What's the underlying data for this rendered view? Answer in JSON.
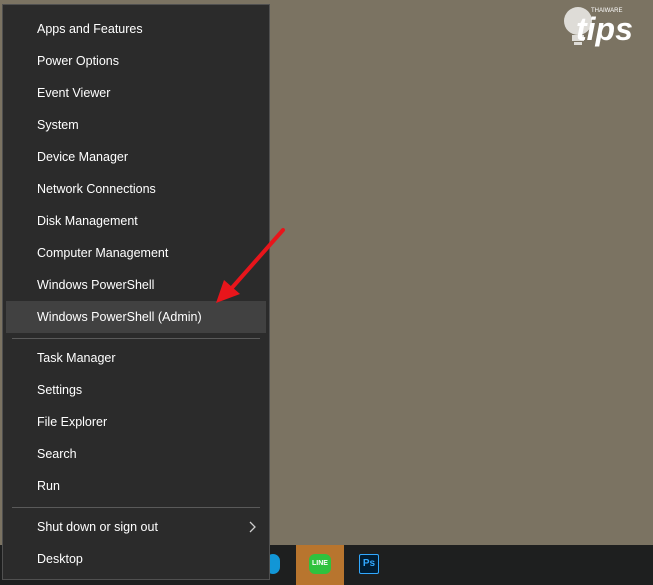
{
  "menu": {
    "group1": [
      {
        "label": "Apps and Features"
      },
      {
        "label": "Power Options"
      },
      {
        "label": "Event Viewer"
      },
      {
        "label": "System"
      },
      {
        "label": "Device Manager"
      },
      {
        "label": "Network Connections"
      },
      {
        "label": "Disk Management"
      },
      {
        "label": "Computer Management"
      },
      {
        "label": "Windows PowerShell"
      },
      {
        "label": "Windows PowerShell (Admin)"
      }
    ],
    "group2": [
      {
        "label": "Task Manager"
      },
      {
        "label": "Settings"
      },
      {
        "label": "File Explorer"
      },
      {
        "label": "Search"
      },
      {
        "label": "Run"
      }
    ],
    "group3": [
      {
        "label": "Shut down or sign out"
      },
      {
        "label": "Desktop"
      }
    ],
    "highlighted_item": "Windows PowerShell (Admin)"
  },
  "taskbar": {
    "apps": [
      {
        "name": "skype",
        "icon": "skype-icon"
      },
      {
        "name": "line",
        "icon": "line-icon",
        "glyph": "LINE",
        "active": true
      },
      {
        "name": "photoshop",
        "icon": "photoshop-icon",
        "glyph": "Ps"
      }
    ]
  },
  "watermark": {
    "brand": "Thaiware",
    "text": "tips"
  },
  "annotation": {
    "type": "red-arrow",
    "color": "#e8151b",
    "points_to": "Windows PowerShell (Admin)"
  },
  "colors": {
    "menu_bg": "#2b2b2b",
    "highlight": "#414141",
    "desktop": "#7b7362",
    "taskbar": "#1e1f1f"
  }
}
